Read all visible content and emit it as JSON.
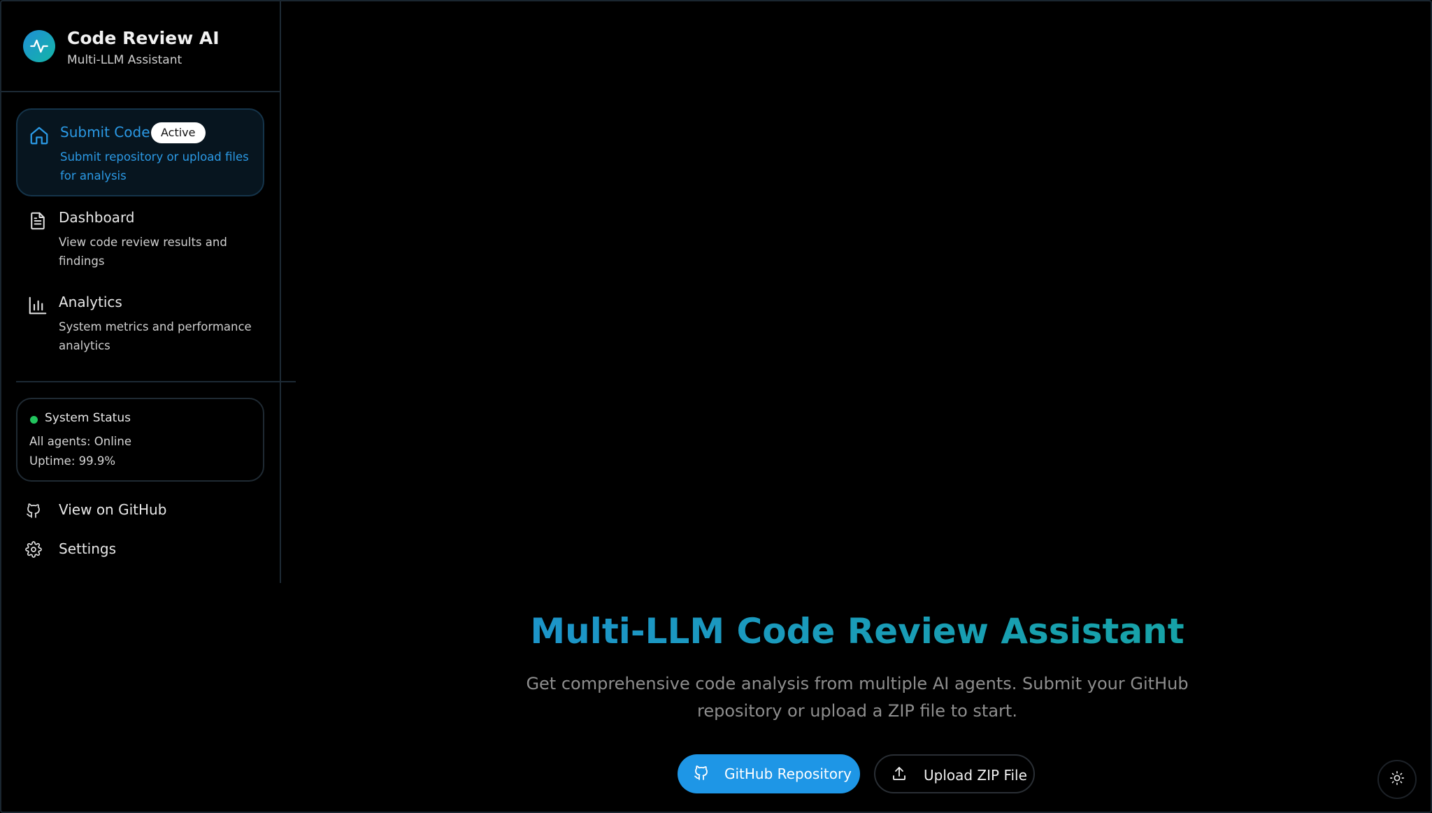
{
  "brand": {
    "title": "Code Review AI",
    "subtitle": "Multi-LLM Assistant",
    "logo_icon": "activity-pulse-icon"
  },
  "nav": {
    "items": [
      {
        "title": "Submit Code",
        "badge": "Active",
        "description": "Submit repository or upload files for analysis",
        "icon": "home-icon",
        "active": true
      },
      {
        "title": "Dashboard",
        "description": "View code review results and findings",
        "icon": "document-icon",
        "active": false
      },
      {
        "title": "Analytics",
        "description": "System metrics and performance analytics",
        "icon": "bar-chart-icon",
        "active": false
      }
    ]
  },
  "status": {
    "title": "System Status",
    "agents": "All agents: Online",
    "uptime": "Uptime: 99.9%",
    "indicator_color": "#22c55e"
  },
  "links": {
    "github": "View on GitHub",
    "settings": "Settings"
  },
  "hero": {
    "title": "Multi-LLM Code Review Assistant",
    "subtitle": "Get comprehensive code analysis from multiple AI agents. Submit your GitHub repository or upload a ZIP file to start."
  },
  "actions": {
    "github_button": "GitHub Repository",
    "upload_button": "Upload ZIP File"
  },
  "colors": {
    "accent": "#1e96e6",
    "accent_teal": "#14a89a"
  }
}
